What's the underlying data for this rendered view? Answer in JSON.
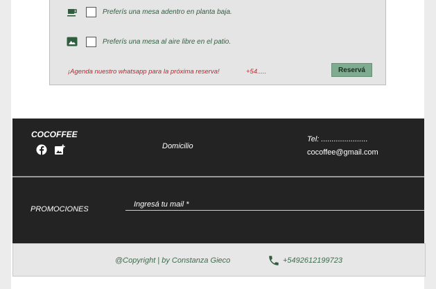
{
  "reservation_form": {
    "options": [
      {
        "icon": "coffee-cup-icon",
        "label": "Preferís una mesa adentro en planta baja.",
        "checked": false
      },
      {
        "icon": "image-landscape-icon",
        "label": "Preferís una mesa al aire libre en el patio.",
        "checked": false
      }
    ],
    "whatsapp_note": "¡Agenda nuestro whatsapp para la próxima reserva!",
    "whatsapp_number": "+54.....",
    "reserve_button": "Reservá"
  },
  "footer": {
    "brand": "COCOFFEE",
    "social_icons": [
      "facebook-icon",
      "add-photo-icon"
    ],
    "address_label": "Domicilio",
    "tel_label": "Tel: ......................",
    "email": "cocoffee@gmail.com",
    "promo_label": "PROMOCIONES",
    "mail_placeholder": "Ingresá tu mail *"
  },
  "copyright_bar": {
    "text": "@Copyright | by Constanza Gieco",
    "phone_icon": "phone-icon",
    "phone": "+5492612199723"
  },
  "colors": {
    "accent_green": "#7fab90",
    "text_green": "#2f5e3f",
    "alert_red": "#c0242a",
    "footer_bg": "#232323"
  }
}
